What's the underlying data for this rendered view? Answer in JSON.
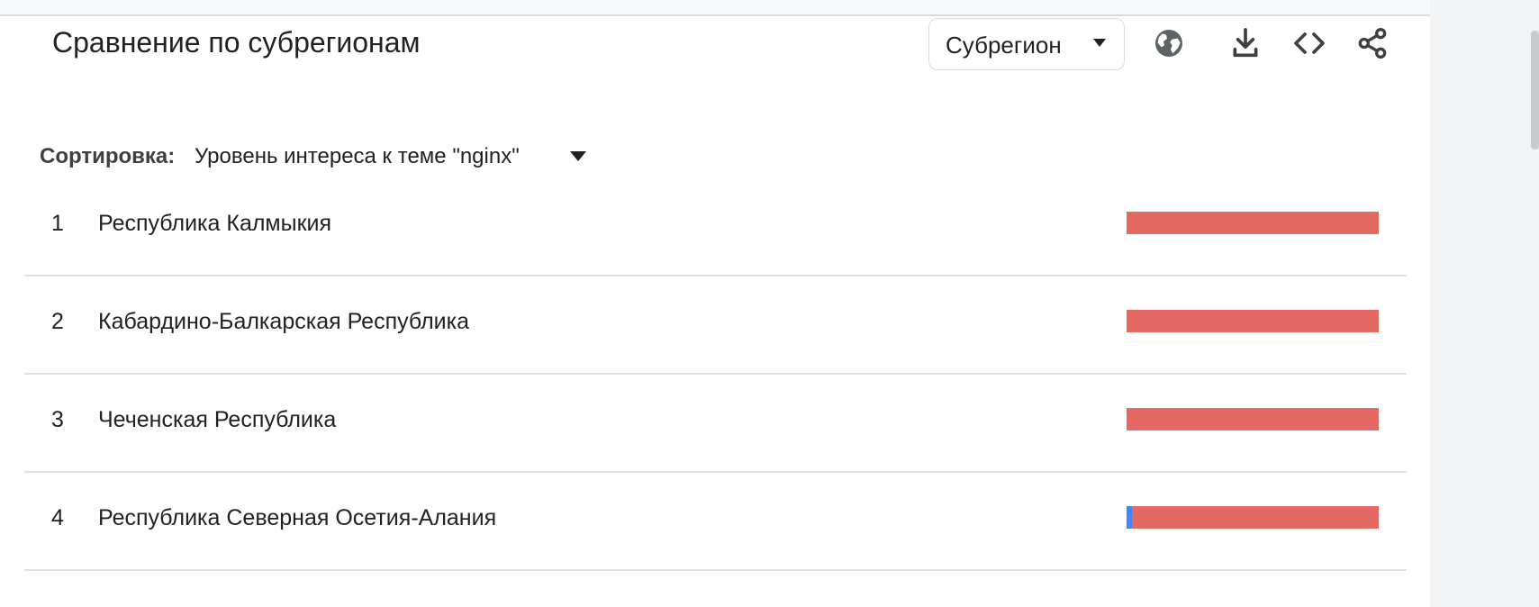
{
  "card": {
    "title": "Сравнение по субрегионам",
    "region_select": {
      "selected": "Субрегион"
    },
    "tools": {
      "globe": "globe-icon",
      "download": "download-icon",
      "embed": "embed-code-icon",
      "share": "share-icon"
    }
  },
  "sort": {
    "label": "Сортировка:",
    "value": "Уровень интереса к теме \"nginx\""
  },
  "colors": {
    "primary_series": "#e46962",
    "secondary_series": "#4285f4"
  },
  "rows": [
    {
      "rank": "1",
      "name": "Республика Калмыкия",
      "share_secondary": 0,
      "share_primary": 100
    },
    {
      "rank": "2",
      "name": "Кабардино-Балкарская Республика",
      "share_secondary": 0,
      "share_primary": 100
    },
    {
      "rank": "3",
      "name": "Чеченская Республика",
      "share_secondary": 0,
      "share_primary": 100
    },
    {
      "rank": "4",
      "name": "Республика Северная Осетия-Алания",
      "share_secondary": 2,
      "share_primary": 98
    }
  ]
}
